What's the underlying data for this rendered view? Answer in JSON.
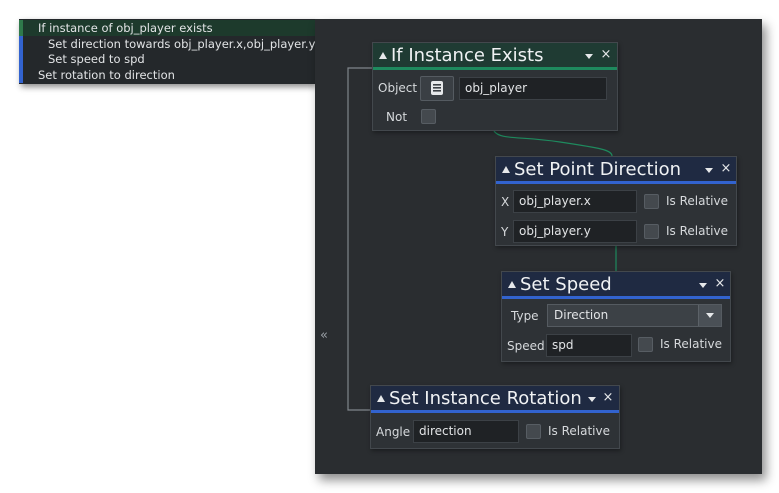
{
  "summary": {
    "lines": [
      {
        "text": "If instance of obj_player exists",
        "indent": 0,
        "marker": "#2f7a4b",
        "highlight": true
      },
      {
        "text": "Set direction towards obj_player.x,obj_player.y)",
        "indent": 1,
        "marker": "#3263cf",
        "highlight": false
      },
      {
        "text": "Set speed to spd",
        "indent": 1,
        "marker": "#3263cf",
        "highlight": false
      },
      {
        "text": "Set rotation to direction",
        "indent": 0,
        "marker": "#3263cf",
        "highlight": false
      }
    ]
  },
  "canvas": {
    "collapse_glyph": "«"
  },
  "icons": {
    "collapse": "double-chevron-left-icon",
    "object": "object-picker-icon",
    "expand": "triangle-up-icon",
    "menu": "chevron-down-icon",
    "close": "close-icon"
  },
  "colors": {
    "condition_accent": "#1e8a5e",
    "action_accent": "#3263cf",
    "wire": "#1e8a5e"
  },
  "blocks": {
    "if_instance_exists": {
      "title": "If Instance Exists",
      "object_label": "Object",
      "object_value": "obj_player",
      "not_label": "Not",
      "not_checked": false
    },
    "set_point_direction": {
      "title": "Set Point Direction",
      "x_label": "X",
      "x_value": "obj_player.x",
      "y_label": "Y",
      "y_value": "obj_player.y",
      "relative_label": "Is Relative",
      "x_relative": false,
      "y_relative": false
    },
    "set_speed": {
      "title": "Set Speed",
      "type_label": "Type",
      "type_value": "Direction",
      "speed_label": "Speed",
      "speed_value": "spd",
      "relative_label": "Is Relative",
      "relative": false
    },
    "set_instance_rotation": {
      "title": "Set Instance Rotation",
      "angle_label": "Angle",
      "angle_value": "direction",
      "relative_label": "Is Relative",
      "relative": false
    }
  },
  "header_glyphs": {
    "close": "×"
  }
}
